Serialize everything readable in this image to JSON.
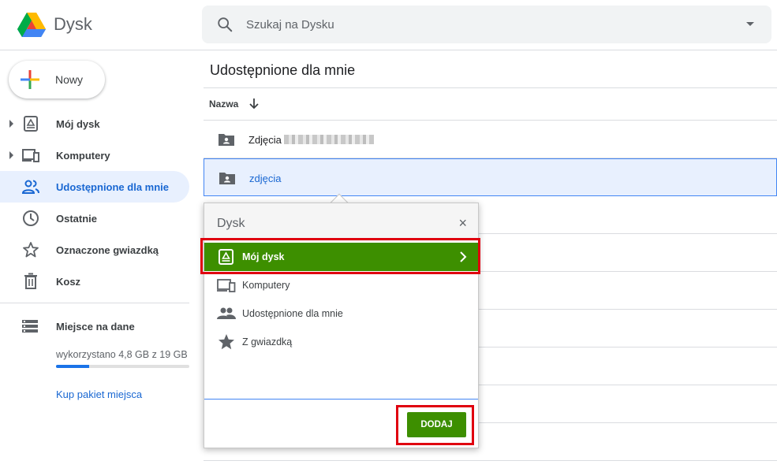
{
  "header": {
    "app_name": "Dysk",
    "search_placeholder": "Szukaj na Dysku"
  },
  "sidebar": {
    "new_label": "Nowy",
    "items": [
      {
        "label": "Mój dysk",
        "icon": "drive-icon",
        "expandable": true
      },
      {
        "label": "Komputery",
        "icon": "computers-icon",
        "expandable": true
      },
      {
        "label": "Udostępnione dla mnie",
        "icon": "shared-icon",
        "active": true
      },
      {
        "label": "Ostatnie",
        "icon": "clock-icon"
      },
      {
        "label": "Oznaczone gwiazdką",
        "icon": "star-icon"
      },
      {
        "label": "Kosz",
        "icon": "trash-icon"
      }
    ],
    "storage": {
      "title": "Miejsce na dane",
      "used_text": "wykorzystano 4,8 GB z 19 GB",
      "used_fraction": 0.25,
      "buy_label": "Kup pakiet miejsca"
    }
  },
  "main": {
    "title": "Udostępnione dla mnie",
    "column_name": "Nazwa",
    "rows": [
      {
        "label": "Zdjęcia",
        "blurred_suffix": true
      },
      {
        "label": "zdjęcia",
        "selected": true
      }
    ]
  },
  "dialog": {
    "title": "Dysk",
    "close": "×",
    "items": [
      {
        "label": "Mój dysk",
        "icon": "drive-icon",
        "active": true
      },
      {
        "label": "Komputery",
        "icon": "computers-icon"
      },
      {
        "label": "Udostępnione dla mnie",
        "icon": "people-icon"
      },
      {
        "label": "Z gwiazdką",
        "icon": "star-icon"
      }
    ],
    "add_label": "DODAJ"
  },
  "colors": {
    "accent_blue": "#1967d2",
    "selected_bg": "#e8f0fe",
    "action_green": "#3d8f00",
    "highlight_red": "#e0000f"
  }
}
